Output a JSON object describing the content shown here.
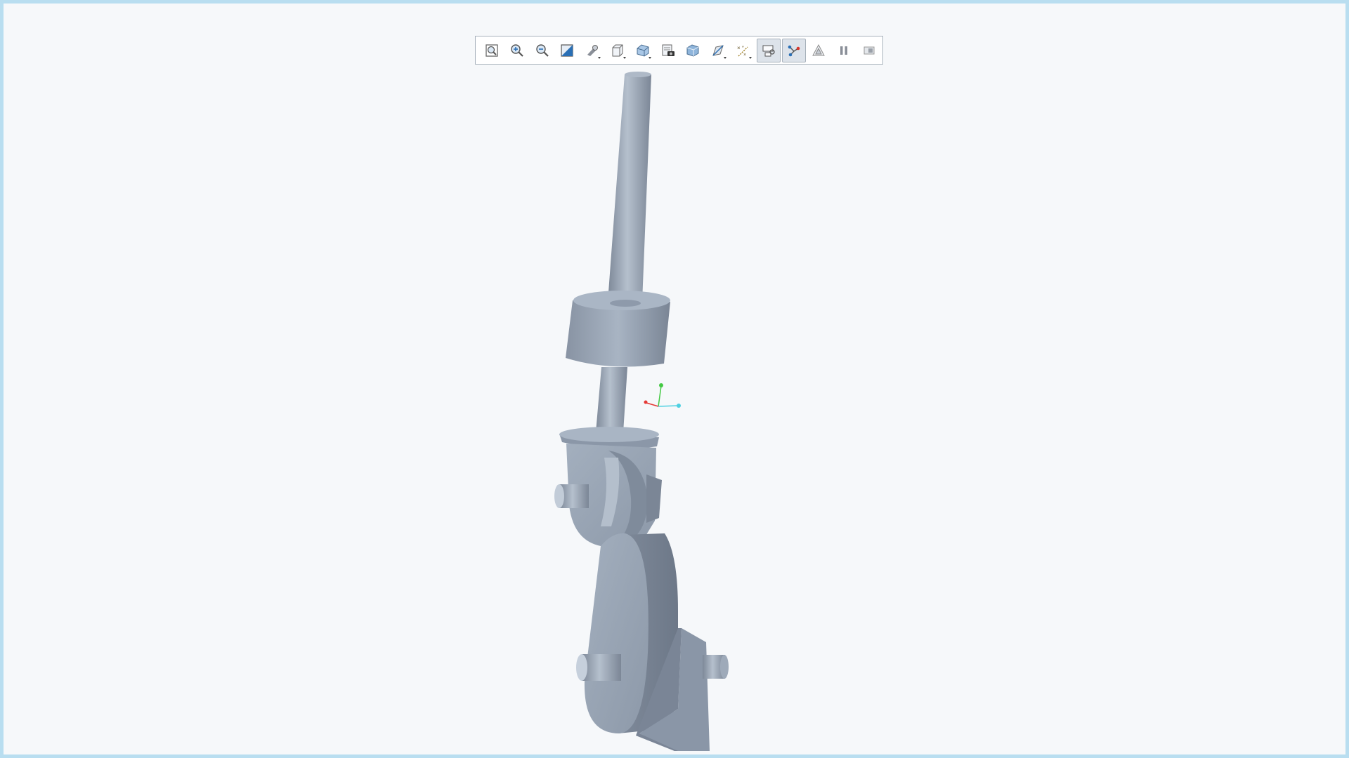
{
  "window": {
    "accent_border": "#b9def0",
    "background": "#f6f8fa"
  },
  "toolbar": {
    "buttons": [
      {
        "name": "refit-icon",
        "active": false,
        "has_menu": false
      },
      {
        "name": "zoom-in-icon",
        "active": false,
        "has_menu": false
      },
      {
        "name": "zoom-out-icon",
        "active": false,
        "has_menu": false
      },
      {
        "name": "repaint-icon",
        "active": false,
        "has_menu": false
      },
      {
        "name": "perspective-icon",
        "active": false,
        "has_menu": true
      },
      {
        "name": "display-style-icon",
        "active": false,
        "has_menu": true
      },
      {
        "name": "saved-orientations-icon",
        "active": false,
        "has_menu": true
      },
      {
        "name": "view-manager-icon",
        "active": false,
        "has_menu": false
      },
      {
        "name": "appearance-icon",
        "active": false,
        "has_menu": false
      },
      {
        "name": "section-icon",
        "active": false,
        "has_menu": true
      },
      {
        "name": "datum-display-icon",
        "active": false,
        "has_menu": true
      },
      {
        "name": "spin-center-icon",
        "active": true,
        "has_menu": false
      },
      {
        "name": "annotation-display-icon",
        "active": true,
        "has_menu": false
      },
      {
        "name": "simplify-icon",
        "active": false,
        "has_menu": false
      },
      {
        "name": "pause-icon",
        "active": false,
        "has_menu": false
      },
      {
        "name": "stop-icon",
        "active": false,
        "has_menu": false
      }
    ]
  },
  "model": {
    "part_color": "#9aa7b7",
    "axis_colors": {
      "x": "#e53935",
      "y": "#43c943",
      "z": "#4dd0e1"
    }
  }
}
